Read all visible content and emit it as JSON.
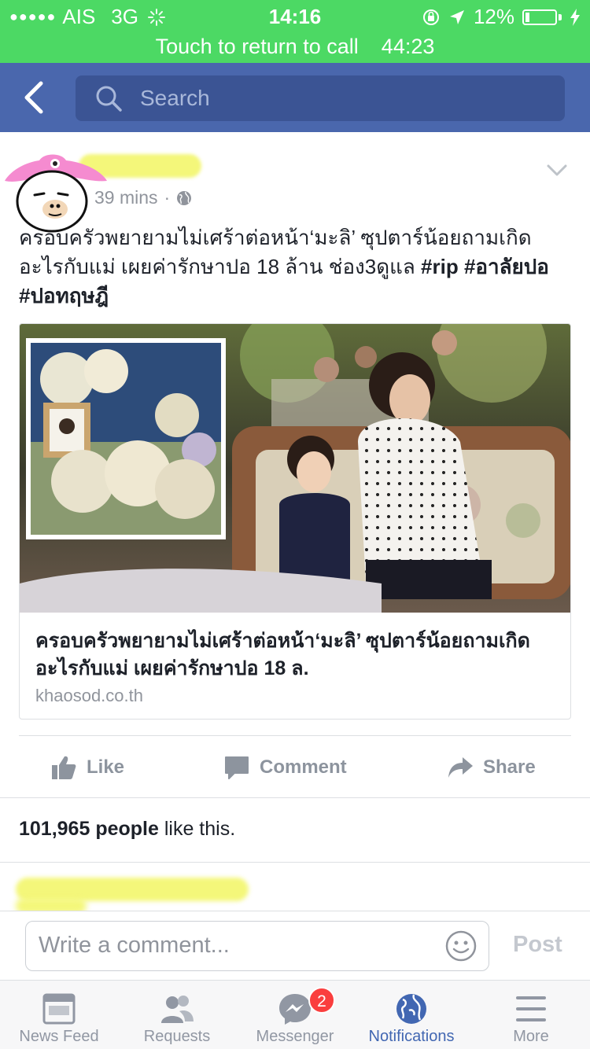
{
  "status_bar": {
    "carrier": "AIS",
    "network": "3G",
    "time": "14:16",
    "battery": "12%"
  },
  "call_banner": {
    "text": "Touch to return to call",
    "duration": "44:23"
  },
  "nav": {
    "search_placeholder": "Search"
  },
  "post": {
    "time": "39 mins",
    "body_text": "ครอบครัวพยายามไม่เศร้าต่อหน้า‘มะลิ’ ซุปตาร์น้อยถามเกิดอะไรกับแม่ เผยค่ารักษาปอ 18 ล้าน ช่อง3ดูแล ",
    "hashtags": [
      "#rip",
      "#อาลัยปอ",
      "#ปอทฤษฎี"
    ],
    "link": {
      "title": "ครอบครัวพยายามไม่เศร้าต่อหน้า‘มะลิ’ ซุปตาร์น้อยถามเกิดอะไรกับแม่ เผยค่ารักษาปอ 18 ล.",
      "domain": "khaosod.co.th"
    },
    "actions": {
      "like": "Like",
      "comment": "Comment",
      "share": "Share"
    },
    "likes_count": "101,965 people",
    "likes_suffix": " like this."
  },
  "composer": {
    "placeholder": "Write a comment...",
    "post_label": "Post"
  },
  "tabs": [
    {
      "label": "News Feed",
      "icon": "news-feed-icon"
    },
    {
      "label": "Requests",
      "icon": "requests-icon"
    },
    {
      "label": "Messenger",
      "icon": "messenger-icon",
      "badge": "2"
    },
    {
      "label": "Notifications",
      "icon": "globe-icon",
      "active": true
    },
    {
      "label": "More",
      "icon": "menu-icon"
    }
  ],
  "colors": {
    "status_green": "#4cd964",
    "nav_blue": "#4a67ad",
    "accent": "#4267b2",
    "badge_red": "#fa3e3e"
  }
}
